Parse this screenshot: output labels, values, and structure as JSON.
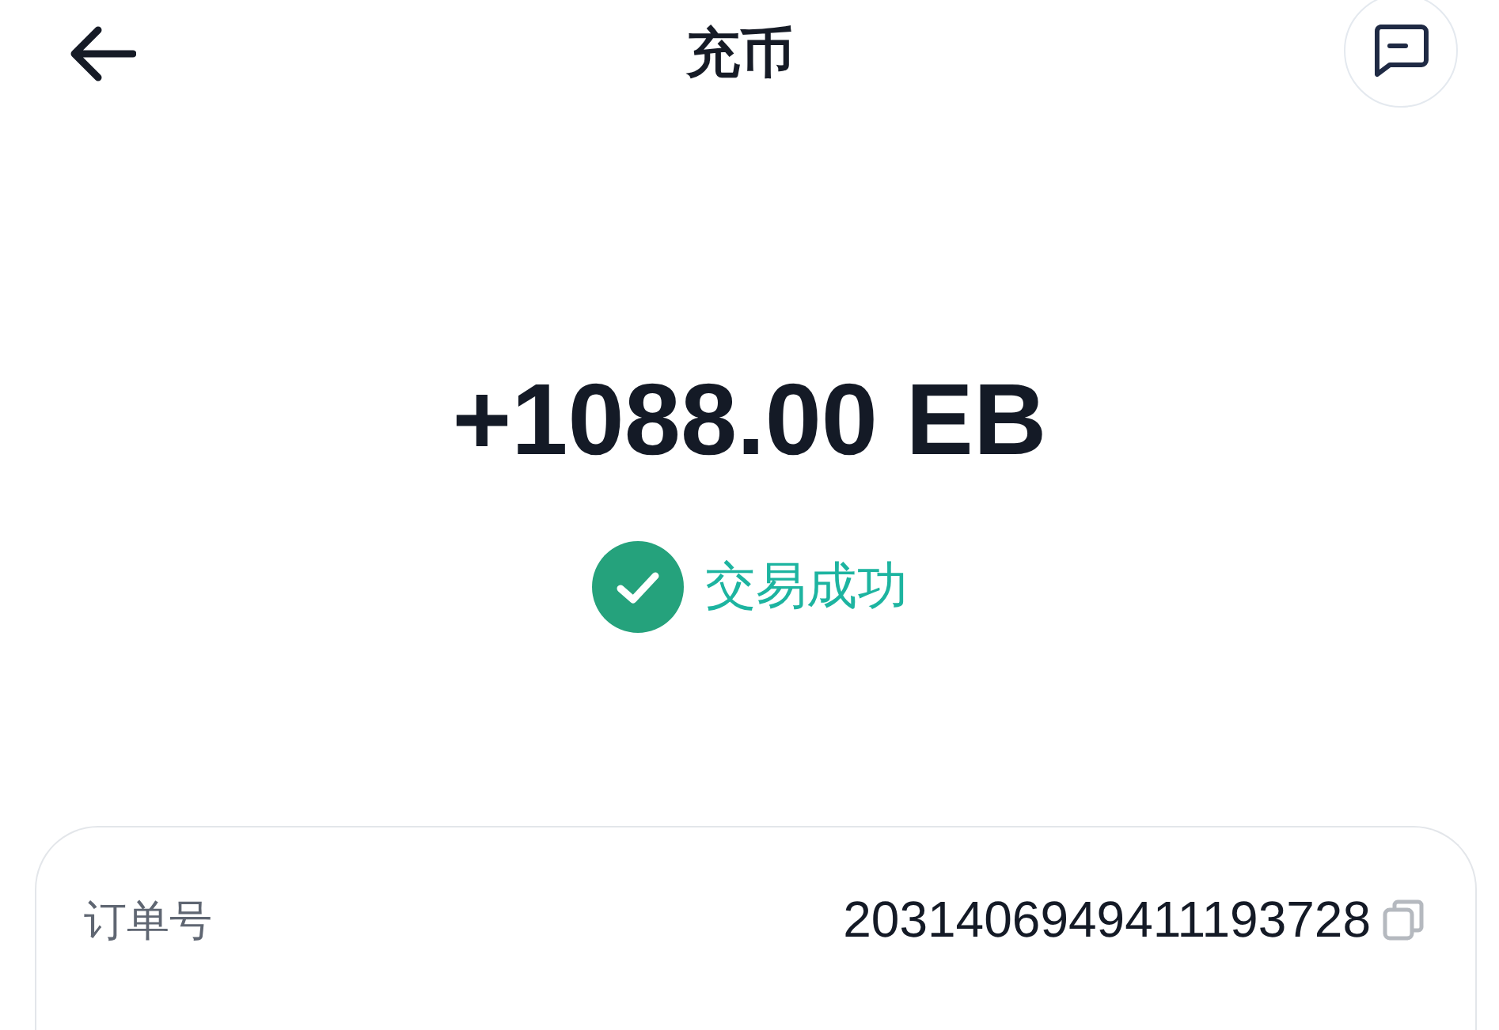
{
  "header": {
    "title": "充币"
  },
  "amount": "+1088.00 EB",
  "status": {
    "kind": "success",
    "label": "交易成功"
  },
  "details": [
    {
      "label": "订单号",
      "value": "2031406949411193728",
      "copyable": true
    }
  ]
}
